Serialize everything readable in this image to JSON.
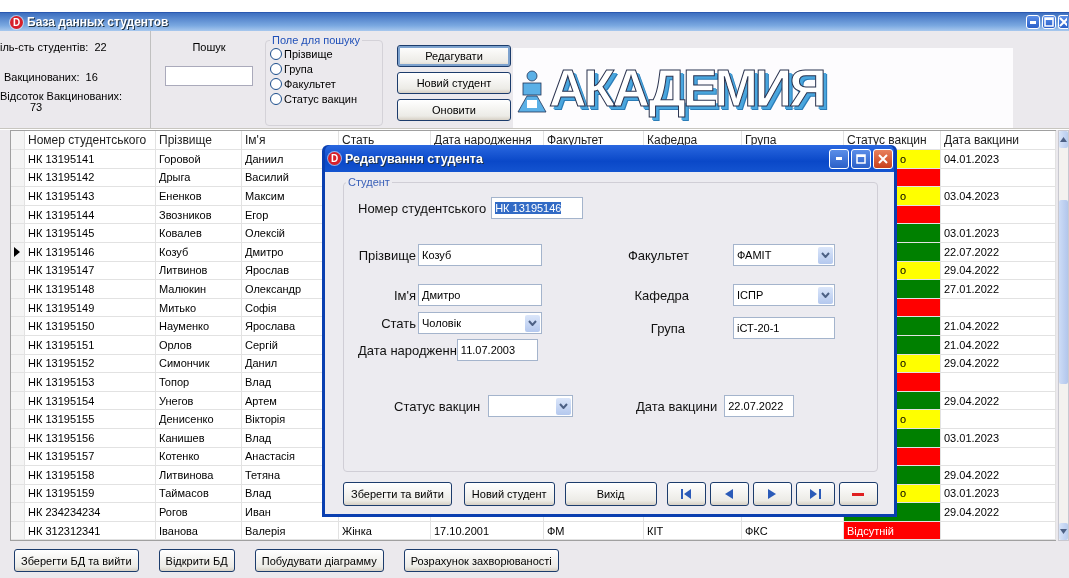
{
  "window": {
    "app_icon": "D",
    "title": "База данных студентов"
  },
  "stats": [
    {
      "label": "іль-сть студентів:",
      "value": "22"
    },
    {
      "label": "Вакцинованих:",
      "value": "16"
    },
    {
      "label": "Відсоток Вакцинованих:",
      "value": "73"
    }
  ],
  "search": {
    "label": "Пошук"
  },
  "search_field": {
    "title": "Поле для пошуку",
    "options": [
      {
        "label": "Прізвище",
        "selected": false
      },
      {
        "label": "Група",
        "selected": false
      },
      {
        "label": "Факультет",
        "selected": false
      },
      {
        "label": "Статус вакцин",
        "selected": false
      }
    ]
  },
  "toolbar_buttons": [
    {
      "label": "Редагувати",
      "focused": true
    },
    {
      "label": "Новий студент",
      "focused": false
    },
    {
      "label": "Оновити",
      "focused": false
    }
  ],
  "logo": {
    "text": "АКАДЕМИЯ"
  },
  "table": {
    "columns": [
      "Номер студентського",
      "Прізвище",
      "Ім'я",
      "Стать",
      "Дата народження",
      "Факультет",
      "Кафедра",
      "Група",
      "Статус вакцин",
      "Дата вакцини"
    ],
    "rows": [
      {
        "selected": false,
        "cells": [
          "НК 13195141",
          "Горовой",
          "Даниил"
        ],
        "status": {
          "color": "#ffff00",
          "text": "о"
        },
        "vaccine_date": "04.01.2023"
      },
      {
        "selected": false,
        "cells": [
          "НК 13195142",
          "Дрыга",
          "Василий"
        ],
        "status": {
          "color": "#ff0000"
        }
      },
      {
        "selected": false,
        "cells": [
          "НК 13195143",
          "Ененков",
          "Максим"
        ],
        "status": {
          "color": "#ffff00",
          "text": "о"
        },
        "vaccine_date": "03.04.2023"
      },
      {
        "selected": false,
        "cells": [
          "НК 13195144",
          "Звозников",
          "Егор"
        ],
        "status": {
          "color": "#ff0000"
        }
      },
      {
        "selected": false,
        "cells": [
          "НК 13195145",
          "Ковалев",
          "Олексій"
        ],
        "status": {
          "color": "#008000"
        },
        "vaccine_date": "03.01.2023"
      },
      {
        "selected": true,
        "cells": [
          "НК 13195146",
          "Козуб",
          "Дмитро"
        ],
        "status": {
          "color": "#008000"
        },
        "vaccine_date": "22.07.2022"
      },
      {
        "selected": false,
        "cells": [
          "НК 13195147",
          "Литвинов",
          "Ярослав"
        ],
        "status": {
          "color": "#ffff00",
          "text": "о"
        },
        "vaccine_date": "29.04.2022"
      },
      {
        "selected": false,
        "cells": [
          "НК 13195148",
          "Малюкин",
          "Олександр"
        ],
        "status": {
          "color": "#008000"
        },
        "vaccine_date": "27.01.2022"
      },
      {
        "selected": false,
        "cells": [
          "НК 13195149",
          "Митько",
          "Софія"
        ],
        "status": {
          "color": "#ff0000"
        }
      },
      {
        "selected": false,
        "cells": [
          "НК 13195150",
          "Науменко",
          "Ярослава"
        ],
        "status": {
          "color": "#008000"
        },
        "vaccine_date": "21.04.2022"
      },
      {
        "selected": false,
        "cells": [
          "НК 13195151",
          "Орлов",
          "Сергій"
        ],
        "status": {
          "color": "#008000"
        },
        "vaccine_date": "21.04.2022"
      },
      {
        "selected": false,
        "cells": [
          "НК 13195152",
          "Симончик",
          "Данил"
        ],
        "status": {
          "color": "#ffff00",
          "text": "о"
        },
        "vaccine_date": "29.04.2022"
      },
      {
        "selected": false,
        "cells": [
          "НК 13195153",
          "Топор",
          "Влад"
        ],
        "status": {
          "color": "#ff0000"
        }
      },
      {
        "selected": false,
        "cells": [
          "НК 13195154",
          "Унегов",
          "Артем"
        ],
        "status": {
          "color": "#008000"
        },
        "vaccine_date": "29.04.2022"
      },
      {
        "selected": false,
        "cells": [
          "НК 13195155",
          "Денисенко",
          "Вікторія"
        ],
        "status": {
          "color": "#ffff00",
          "text": "о"
        }
      },
      {
        "selected": false,
        "cells": [
          "НК 13195156",
          "Канишев",
          "Влад"
        ],
        "status": {
          "color": "#008000"
        },
        "vaccine_date": "03.01.2023"
      },
      {
        "selected": false,
        "cells": [
          "НК 13195157",
          "Котенко",
          "Анастасія"
        ],
        "status": {
          "color": "#ff0000"
        }
      },
      {
        "selected": false,
        "cells": [
          "НК 13195158",
          "Литвинова",
          "Тетяна"
        ],
        "status": {
          "color": "#008000"
        },
        "vaccine_date": "29.04.2022"
      },
      {
        "selected": false,
        "cells": [
          "НК 13195159",
          "Таймасов",
          "Влад"
        ],
        "status": {
          "color": "#ffff00",
          "text": "о"
        },
        "vaccine_date": "03.01.2023"
      },
      {
        "selected": false,
        "cells": [
          "НК 234234234",
          "Рогов",
          "Иван"
        ],
        "status": {
          "color": "#008000"
        },
        "vaccine_date": "29.04.2022"
      },
      {
        "selected": false,
        "cells": [
          "НК 312312341",
          "Іванова",
          "Валерія",
          "Жінка",
          "17.10.2001",
          "ФМ",
          "КІТ",
          "ФКС"
        ],
        "status": {
          "color": "#ff0000",
          "text": "Відсутній"
        }
      }
    ]
  },
  "dialog": {
    "app_icon": "D",
    "title": "Редагування студента",
    "group": "Студент",
    "fields": [
      {
        "kind": "text",
        "label": "Номер студентського",
        "value": "НК 13195146",
        "text_selected": true
      },
      {
        "kind": "text",
        "label": "Прізвище",
        "value": "Козуб",
        "text_selected": false
      },
      {
        "kind": "combo",
        "label": "Факультет",
        "value": "ФАМІТ"
      },
      {
        "kind": "text",
        "label": "Ім'я",
        "value": "Дмитро",
        "text_selected": false
      },
      {
        "kind": "combo",
        "label": "Кафедра",
        "value": "ІСПР"
      },
      {
        "kind": "combo",
        "label": "Стать",
        "value": "Чоловік"
      },
      {
        "kind": "text",
        "label": "Група",
        "value": "іСТ-20-1",
        "text_selected": false
      },
      {
        "kind": "text",
        "label": "Дата народженн",
        "value": "11.07.2003",
        "text_selected": false
      },
      {
        "kind": "combo",
        "label": "Статус вакцин"
      },
      {
        "kind": "text",
        "label": "Дата вакцини",
        "value": "22.07.2022",
        "text_selected": false
      }
    ],
    "buttons": [
      {
        "kind": "text",
        "label": "Зберегти та вийти"
      },
      {
        "kind": "text",
        "label": "Новий студент"
      },
      {
        "kind": "text",
        "label": "Вихід"
      },
      {
        "kind": "first"
      },
      {
        "kind": "prev"
      },
      {
        "kind": "next"
      },
      {
        "kind": "last"
      },
      {
        "kind": "delete"
      }
    ]
  },
  "bottom_buttons": [
    "Зберегти БД та вийти",
    "Відкрити БД",
    "Побудувати діаграмму",
    "Розрахунок захворюваності"
  ]
}
